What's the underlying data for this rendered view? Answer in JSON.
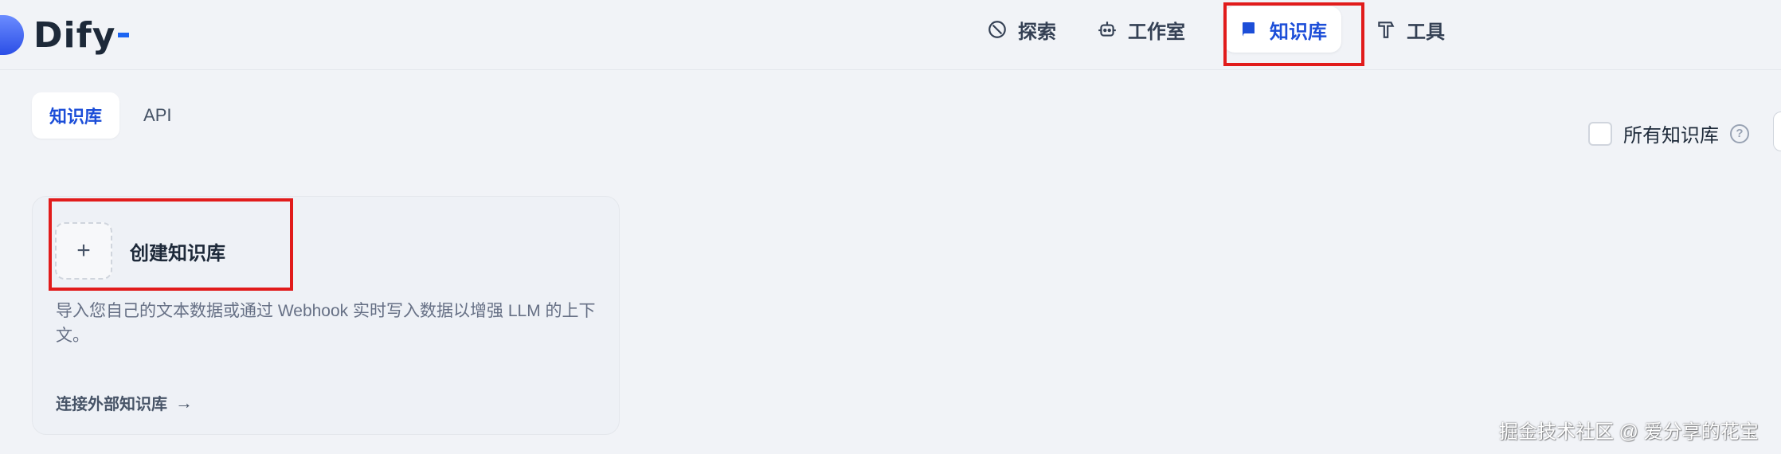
{
  "app": {
    "logo_text": "Dify"
  },
  "nav": {
    "items": [
      {
        "label": "探索",
        "icon": "compass-icon",
        "active": false
      },
      {
        "label": "工作室",
        "icon": "robot-icon",
        "active": false
      },
      {
        "label": "知识库",
        "icon": "book-icon",
        "active": true
      },
      {
        "label": "工具",
        "icon": "hammer-icon",
        "active": false
      }
    ]
  },
  "tabs": [
    {
      "label": "知识库",
      "active": true
    },
    {
      "label": "API",
      "active": false
    }
  ],
  "filter": {
    "label": "所有知识库",
    "checked": false,
    "help_icon": "question-circle-icon"
  },
  "create_card": {
    "plus": "+",
    "title": "创建知识库",
    "description": "导入您自己的文本数据或通过 Webhook 实时写入数据以增强 LLM 的上下文。",
    "link_label": "连接外部知识库",
    "link_arrow": "→"
  },
  "watermark": "掘金技术社区 @ 爱分享的花宝",
  "colors": {
    "accent": "#1c4ed8",
    "highlight_box": "#e11b1b",
    "background": "#f1f3f7"
  }
}
